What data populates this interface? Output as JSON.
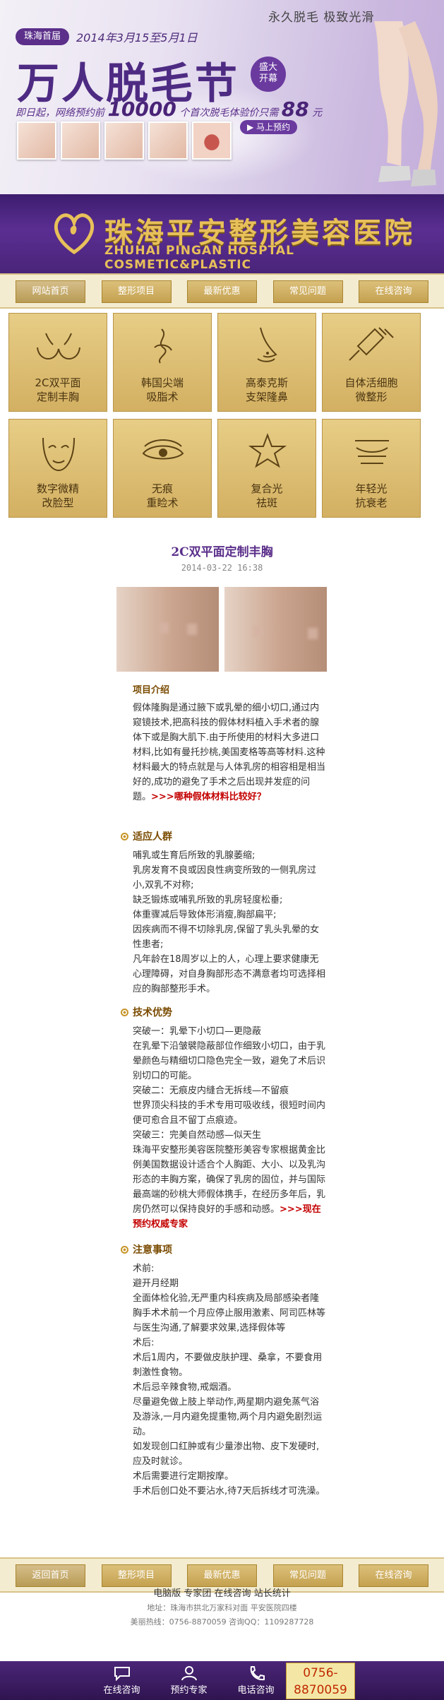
{
  "promo": {
    "tag": "珠海首届",
    "date": "2014年3月15至5月1日",
    "slogan": "永久脱毛  极致光滑",
    "title": "万人脱毛节",
    "badge_line1": "盛大",
    "badge_line2": "开幕",
    "offer_prefix": "即日起，网络预约前",
    "offer_count": "10000",
    "offer_middle": "个首次脱毛体验价只需",
    "offer_price": "88",
    "offer_unit": "元",
    "reserve_label": "▶ 马上预约"
  },
  "banner": {
    "name_cn": "珠海平安整形美容医院",
    "name_en": "ZHUHAI PINGAN HOSPTAL COSMETIC&PLASTIC"
  },
  "nav_top": [
    "网站首页",
    "整形项目",
    "最新优惠",
    "常见问题",
    "在线咨询"
  ],
  "nav_bottom": [
    "返回首页",
    "整形项目",
    "最新优惠",
    "常见问题",
    "在线咨询"
  ],
  "projects": [
    {
      "icon": "breast-icon",
      "line1": "2C双平面",
      "line2": "定制丰胸"
    },
    {
      "icon": "nose-tip-icon",
      "line1": "韩国尖端",
      "line2": "吸脂术"
    },
    {
      "icon": "nose-profile-icon",
      "line1": "高泰克斯",
      "line2": "支架隆鼻"
    },
    {
      "icon": "syringe-icon",
      "line1": "自体活细胞",
      "line2": "微整形"
    },
    {
      "icon": "face-icon",
      "line1": "数字微精",
      "line2": "改脸型"
    },
    {
      "icon": "scar-icon",
      "line1": "无痕",
      "line2": "重睑术"
    },
    {
      "icon": "star-face-icon",
      "line1": "复合光",
      "line2": "祛斑"
    },
    {
      "icon": "eye-wrinkle-icon",
      "line1": "年轻光",
      "line2": "抗衰老"
    }
  ],
  "article": {
    "title": "2C双平面定制丰胸",
    "date": "2014-03-22 16:38",
    "intro_heading": "项目介绍",
    "intro_text": "假体隆胸是通过腋下或乳晕的细小切口,通过内窥镜技术,把高科技的假体材料植入手术者的腺体下或是胸大肌下.由于所使用的材料大多进口材料,比如有曼托抄桃,美国麦格等高等材料.这种材料最大的特点就是与人体乳房的相容相是相当好的,成功的避免了手术之后出现并发症的问题。",
    "intro_link": ">>>哪种假体材料比较好？",
    "crowd_heading": "适应人群",
    "crowd_lines": [
      "哺乳或生育后所致的乳腺萎缩;",
      "乳房发育不良或因良性病变所致的一侧乳房过小,双乳不对称;",
      "缺乏锻炼或哺乳所致的乳房轻度松垂;",
      "体重骤减后导致体形消瘦,胸部扁平;",
      "因疾病而不得不切除乳房,保留了乳头乳晕的女性患者;",
      "凡年龄在18周岁以上的人，心理上要求健康无心理障碍，对自身胸部形态不满意者均可选择相应的胸部整形手术。"
    ],
    "adv_heading": "技术优势",
    "adv_lines": [
      "突破一：乳晕下小切口—更隐蔽",
      "在乳晕下沿皱襞隐蔽部位作细致小切口，由于乳晕颜色与精细切口隐色完全一致，避免了术后识别切口的可能。",
      "突破二：无痕皮内缝合无拆线—不留痕",
      "世界顶尖科技的手术专用可吸收线，很短时间内便可愈合且不留丁点痕迹。",
      "突破三：完美自然动感—似天生",
      "珠海平安整形美容医院整形美容专家根据黄金比例美国数据设计适合个人胸距、大小、以及乳沟形态的丰胸方案，确保了乳房的固位，并与国际最高端的砂桃大师假体携手，在经历多年后，乳房仍然可以保持良好的手感和动感。"
    ],
    "adv_link": ">>>现在预约权威专家",
    "care_heading": "注意事项",
    "care_lines": [
      "术前:",
      "避开月经期",
      "全面体检化验,无严重内科疾病及局部感染者隆胸手术术前一个月应停止服用激素、阿司匹林等",
      "与医生沟通,了解要求效果,选择假体等",
      "术后:",
      "术后1周内，不要做皮肤护理、桑拿，不要食用刺激性食物。",
      "术后忌辛辣食物,戒烟酒。",
      "尽量避免做上肢上举动作,两星期内避免蒸气浴及游泳,一月内避免提重物,两个月内避免剧烈运动。",
      "如发现创口红肿或有少量渗出物、皮下发硬时,应及时就诊。",
      "术后需要进行定期按摩。",
      "手术后创口处不要沾水,待7天后拆线才可洗澡。"
    ]
  },
  "footer": {
    "links": "电脑版  专家团  在线咨询  站长统计",
    "address": "地址：珠海市拱北万家科对面  平安医院四楼",
    "tel": "美丽热线：0756-8870059  咨询QQ：1109287728"
  },
  "bottom_bar": {
    "consult": "在线咨询",
    "expert": "预约专家",
    "phone": "电话咨询",
    "hotline_1": "0756-",
    "hotline_2": "8870059"
  },
  "colors": {
    "purple": "#4e2b83",
    "gold": "#d3b062",
    "red": "#c40000"
  }
}
